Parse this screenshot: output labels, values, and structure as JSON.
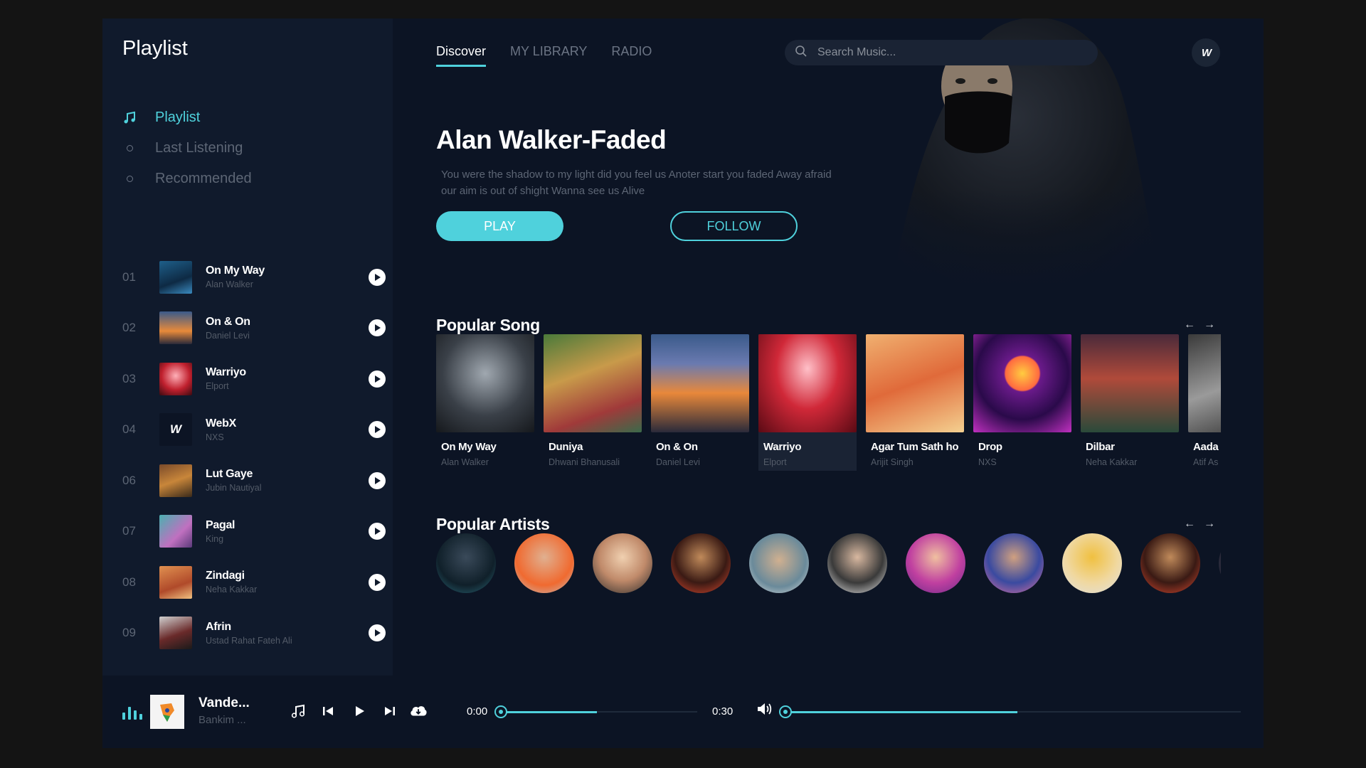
{
  "sidebar": {
    "title": "Playlist",
    "nav": [
      {
        "label": "Playlist",
        "icon": "music-note-icon",
        "active": true
      },
      {
        "label": "Last Listening",
        "icon": "circle-icon",
        "active": false
      },
      {
        "label": "Recommended",
        "icon": "circle-icon",
        "active": false
      }
    ],
    "tracks": [
      {
        "num": "01",
        "title": "On My Way",
        "artist": "Alan Walker"
      },
      {
        "num": "02",
        "title": "On & On",
        "artist": "Daniel Levi"
      },
      {
        "num": "03",
        "title": "Warriyo",
        "artist": "Elport"
      },
      {
        "num": "04",
        "title": "WebX",
        "artist": "NXS"
      },
      {
        "num": "06",
        "title": "Lut Gaye",
        "artist": "Jubin Nautiyal"
      },
      {
        "num": "07",
        "title": "Pagal",
        "artist": "King"
      },
      {
        "num": "08",
        "title": "Zindagi",
        "artist": "Neha Kakkar"
      },
      {
        "num": "09",
        "title": "Afrin",
        "artist": "Ustad Rahat Fateh Ali"
      }
    ]
  },
  "header": {
    "tabs": [
      {
        "label": "Discover",
        "active": true
      },
      {
        "label": "MY LIBRARY",
        "active": false
      },
      {
        "label": "RADIO",
        "active": false
      }
    ],
    "search_placeholder": "Search Music...",
    "logo_text": "W"
  },
  "hero": {
    "title": "Alan Walker-Faded",
    "description": "You were the shadow to my light did you feel us Anoter start you faded Away afraid our aim is out of shight Wanna see us Alive",
    "play_label": "PLAY",
    "follow_label": "FOLLOW"
  },
  "popular_songs": {
    "title": "Popular Song",
    "items": [
      {
        "title": "On My Way",
        "artist": "Alan Walker"
      },
      {
        "title": "Duniya",
        "artist": "Dhwani Bhanusali"
      },
      {
        "title": "On & On",
        "artist": "Daniel Levi"
      },
      {
        "title": "Warriyo",
        "artist": "Elport"
      },
      {
        "title": "Agar Tum Sath ho",
        "artist": "Arijit Singh"
      },
      {
        "title": "Drop",
        "artist": "NXS"
      },
      {
        "title": "Dilbar",
        "artist": "Neha Kakkar"
      },
      {
        "title": "Aada",
        "artist": "Atif As"
      }
    ]
  },
  "popular_artists": {
    "title": "Popular Artists",
    "count": 10
  },
  "player": {
    "title": "Vande...",
    "artist": "Bankim ...",
    "current_time": "0:00",
    "duration": "0:30",
    "progress": 0.49,
    "volume": 0.51
  },
  "colors": {
    "accent": "#4fd1dc",
    "background": "#0c1424",
    "sidebar": "#101a2c"
  }
}
